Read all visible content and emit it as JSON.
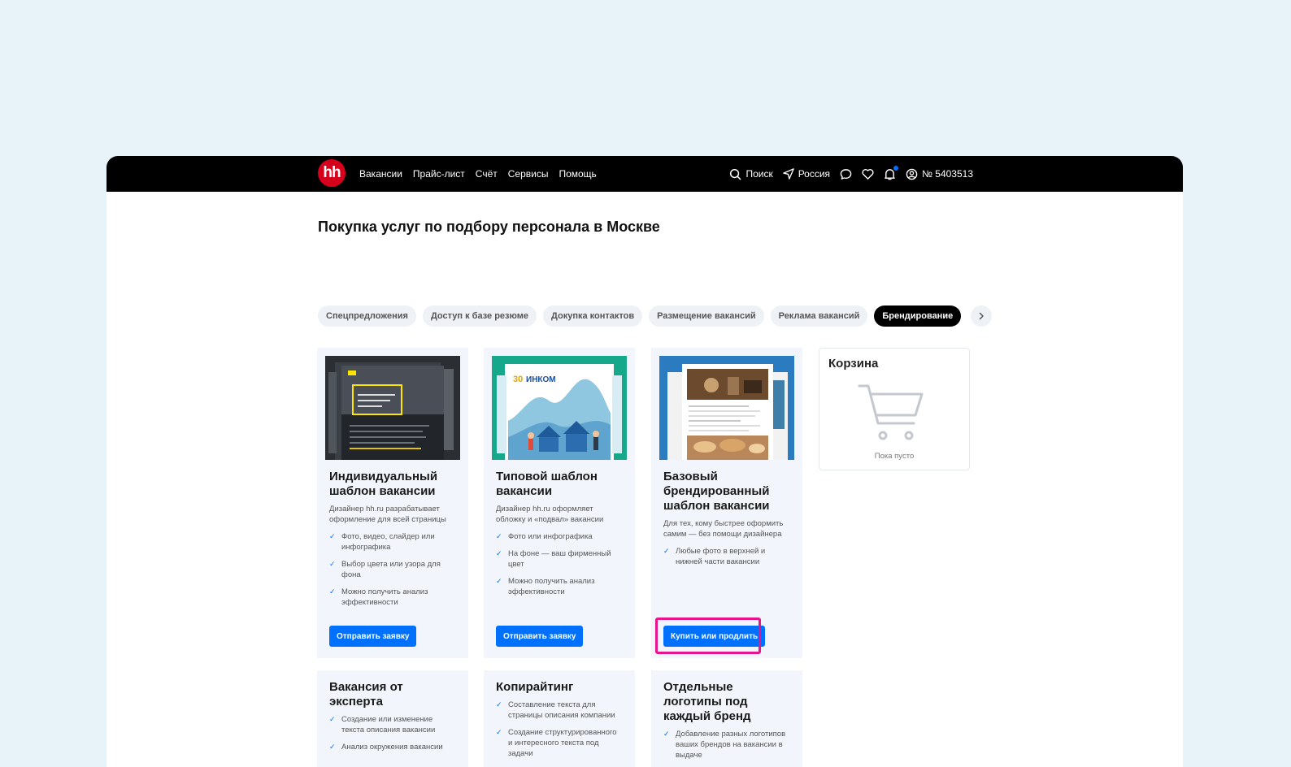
{
  "header": {
    "logo_text": "hh",
    "nav": [
      "Вакансии",
      "Прайс-лист",
      "Счёт",
      "Сервисы",
      "Помощь"
    ],
    "search_label": "Поиск",
    "region_label": "Россия",
    "account_label": "№ 5403513"
  },
  "page": {
    "title": "Покупка услуг по подбору персонала в Москве"
  },
  "tabs": [
    "Спецпредложения",
    "Доступ к базе резюме",
    "Докупка контактов",
    "Размещение вакансий",
    "Реклама вакансий",
    "Брендирование"
  ],
  "active_tab": "Брендирование",
  "cards": [
    {
      "title": "Индивидуальный шаблон вакансии",
      "desc": "Дизайнер hh.ru разрабатывает оформление для всей страницы",
      "features": [
        "Фото, видео, слайдер или инфографика",
        "Выбор цвета или узора для фона",
        "Можно получить анализ эффективности"
      ],
      "button": "Отправить заявку",
      "image_text": "Как ваша карьера может сделать мир лучше?"
    },
    {
      "title": "Типовой шаблон вакансии",
      "desc": "Дизайнер hh.ru оформляет обложку и «подвал» вакансии",
      "features": [
        "Фото или инфографика",
        "На фоне — ваш фирменный цвет",
        "Можно получить анализ эффективности"
      ],
      "button": "Отправить заявку",
      "image_text": "30 ИНКОМ"
    },
    {
      "title": "Базовый брендированный шаблон вакансии",
      "desc": "Для тех, кому быстрее оформить самим — без помощи дизайнера",
      "features": [
        "Любые фото в верхней и нижней части вакансии"
      ],
      "button": "Купить или продлить"
    },
    {
      "title": "Вакансия от эксперта",
      "features": [
        "Создание или изменение текста описания вакансии",
        "Анализ окружения вакансии"
      ]
    },
    {
      "title": "Копирайтинг",
      "features": [
        "Составление текста для страницы описания компании",
        "Создание структурированного и интересного текста под задачи"
      ]
    },
    {
      "title": "Отдельные логотипы под каждый бренд",
      "features": [
        "Добавление разных логотипов ваших брендов на вакансии в выдаче"
      ]
    }
  ],
  "cart": {
    "title": "Корзина",
    "empty_text": "Пока пусто"
  },
  "colors": {
    "accent": "#0070ff",
    "brand_red": "#d6001c",
    "highlight": "#e6158c",
    "page_bg": "#e8f2f9",
    "card_bg": "#f2f5fb"
  }
}
